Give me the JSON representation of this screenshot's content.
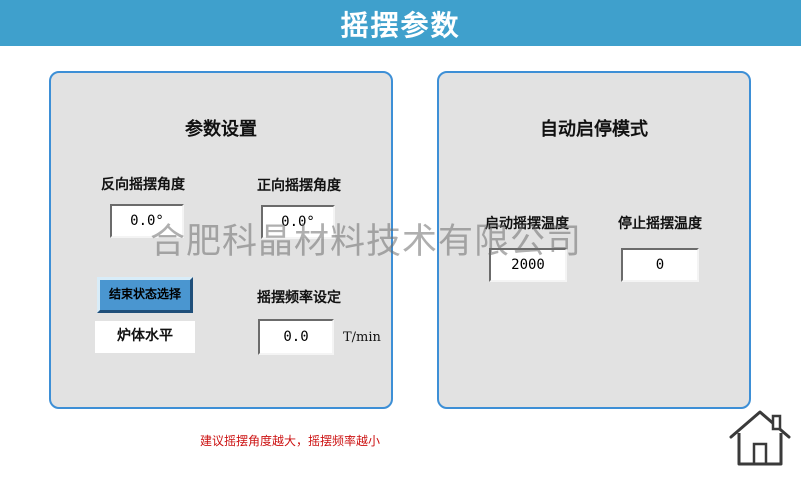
{
  "header": {
    "title": "摇摆参数"
  },
  "params_panel": {
    "title": "参数设置",
    "reverse_angle": {
      "label": "反向摇摆角度",
      "value": "0.0°"
    },
    "forward_angle": {
      "label": "正向摇摆角度",
      "value": "0.0°"
    },
    "end_state_button": "结束状态选择",
    "end_state_value": "炉体水平",
    "frequency": {
      "label": "摇摆频率设定",
      "value": "0.0",
      "unit": "T/min"
    }
  },
  "auto_panel": {
    "title": "自动启停模式",
    "start_temp": {
      "label": "启动摇摆温度",
      "value": "2000"
    },
    "stop_temp": {
      "label": "停止摇摆温度",
      "value": "0"
    }
  },
  "watermark": "合肥科晶材料技术有限公司",
  "hint": "建议摇摆角度越大，摇摆频率越小",
  "icons": {
    "home": "home-icon"
  },
  "colors": {
    "title_bar": "#3fa0cc",
    "panel_border": "#3d8fd6",
    "button": "#4a96d0",
    "hint": "#cc1111"
  }
}
